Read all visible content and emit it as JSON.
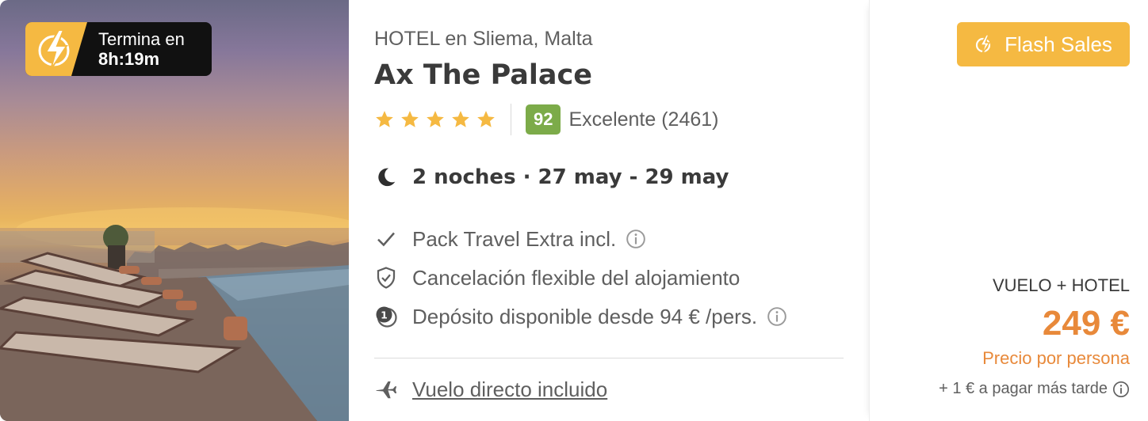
{
  "timer": {
    "label": "Termina en",
    "value": "8h:19m"
  },
  "hotel": {
    "category": "HOTEL en Sliema, Malta",
    "name": "Ax The Palace",
    "stars": 5,
    "score": "92",
    "score_text": "Excelente (2461)"
  },
  "stay": {
    "text": "2 noches · 27 may - 29 may"
  },
  "features": [
    {
      "text": "Pack Travel Extra incl.",
      "icon": "check-icon"
    },
    {
      "text": "Cancelación flexible del alojamiento",
      "icon": "shield-check-icon"
    },
    {
      "text": "Depósito disponible desde 94 € /pers.",
      "icon": "deposit-icon"
    }
  ],
  "flight": {
    "text": "Vuelo directo incluido"
  },
  "pricing": {
    "flash_label": "Flash Sales",
    "package_type": "VUELO + HOTEL",
    "price": "249 €",
    "price_note": "Precio por persona",
    "extra_fee": "+ 1 € a pagar más tarde"
  },
  "colors": {
    "accent": "#f5b942",
    "price": "#e8893a",
    "score": "#7cab49"
  }
}
